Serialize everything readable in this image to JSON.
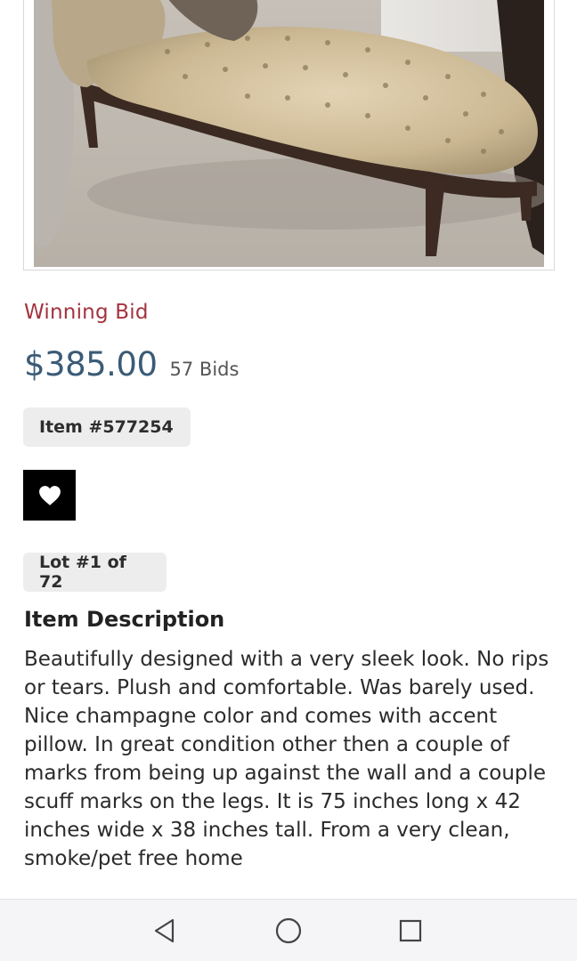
{
  "listing": {
    "photo_alt": "",
    "winning_label": "Winning Bid",
    "price": "$385.00",
    "bids": "57 Bids",
    "item_number": "Item #577254",
    "lot": "Lot #1 of 72",
    "description_title": "Item Description",
    "description": "Beautifully designed with a very sleek look. No rips or tears. Plush and comfortable. Was barely used. Nice champagne color and comes with accent pillow. In great condition other then a couple of marks from being up against the wall and a couple scuff marks on the legs. It is 75 inches long x 42 inches wide x 38 inches tall. From a very clean, smoke/pet free home"
  },
  "favorite": {
    "icon": "heart-icon"
  },
  "navbar": {
    "back_icon": "triangle-back-icon",
    "home_icon": "circle-home-icon",
    "recent_icon": "square-recents-icon"
  },
  "colors": {
    "winning_label": "#a3343f",
    "price": "#3a5b76",
    "chip_bg": "#ededed",
    "fav_bg": "#000000"
  }
}
